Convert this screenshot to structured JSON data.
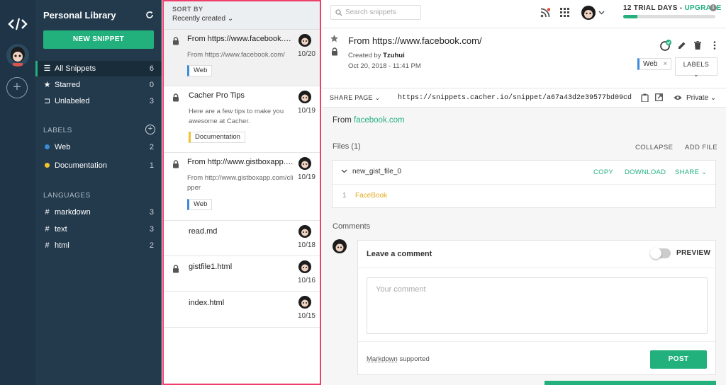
{
  "sidebar": {
    "title": "Personal Library",
    "new_snippet": "NEW SNIPPET",
    "nav": [
      {
        "label": "All Snippets",
        "count": "6"
      },
      {
        "label": "Starred",
        "count": "0"
      },
      {
        "label": "Unlabeled",
        "count": "3"
      }
    ],
    "labels_header": "LABELS",
    "labels": [
      {
        "label": "Web",
        "count": "2",
        "color": "#3b8bd9"
      },
      {
        "label": "Documentation",
        "count": "1",
        "color": "#f2c12e"
      }
    ],
    "languages_header": "LANGUAGES",
    "languages": [
      {
        "label": "markdown",
        "count": "3"
      },
      {
        "label": "text",
        "count": "3"
      },
      {
        "label": "html",
        "count": "2"
      }
    ]
  },
  "list": {
    "sort_by": "SORT BY",
    "sort_value": "Recently created",
    "items": [
      {
        "title": "From https://www.facebook.com/",
        "desc": "From https://www.facebook.com/",
        "date": "10/20",
        "tag": "Web"
      },
      {
        "title": "Cacher Pro Tips",
        "desc": "Here are a few tips to make you awesome at Cacher.",
        "date": "10/19",
        "tag": "Documentation"
      },
      {
        "title": "From http://www.gistboxapp.com/",
        "desc": "From http://www.gistboxapp.com/clipper",
        "date": "10/19",
        "tag": "Web"
      },
      {
        "title": "read.md",
        "date": "10/18"
      },
      {
        "title": "gistfile1.html",
        "date": "10/16"
      },
      {
        "title": "index.html",
        "date": "10/15"
      }
    ]
  },
  "topbar": {
    "search_placeholder": "Search snippets",
    "trial_text": "12 TRIAL DAYS - ",
    "upgrade": "UPGRADE",
    "trial_progress": 0.15
  },
  "snippet": {
    "title": "From https://www.facebook.com/",
    "created_by_prefix": "Created by ",
    "author": "Tzuhui",
    "date": "Oct 20, 2018 - 11:41 PM",
    "tag": "Web",
    "tag_remove": "×",
    "labels_btn": "LABELS",
    "share_page": "SHARE PAGE",
    "url": "https://snippets.cacher.io/snippet/a67a43d2e39577bd09cd",
    "privacy": "Private",
    "from_prefix": "From ",
    "from_link": "facebook.com",
    "files_label": "Files (1)",
    "collapse": "COLLAPSE",
    "add_file": "ADD FILE",
    "file_name": "new_gist_file_0",
    "copy": "COPY",
    "download": "DOWNLOAD",
    "share": "SHARE",
    "line_no": "1",
    "code": "FaceBook"
  },
  "comments": {
    "header": "Comments",
    "leave": "Leave a comment",
    "preview": "PREVIEW",
    "placeholder": "Your comment",
    "markdown": "Markdown",
    "supported": " supported",
    "post": "POST"
  }
}
